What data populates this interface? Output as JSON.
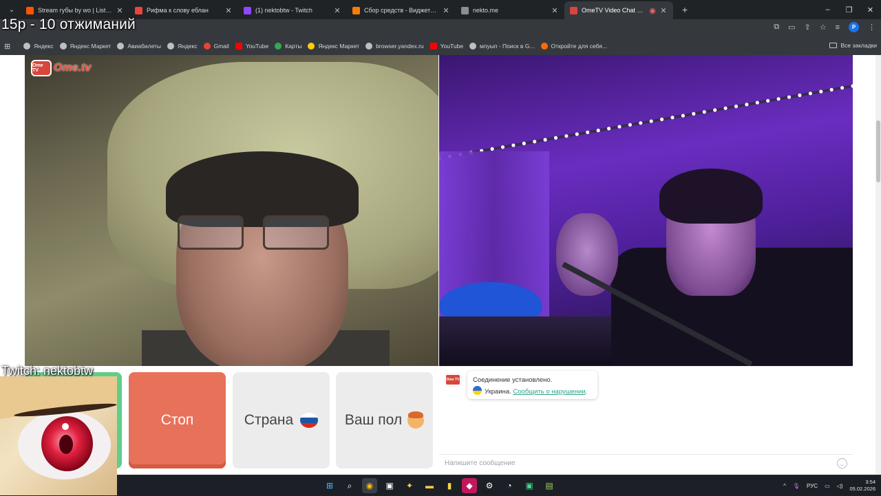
{
  "browser": {
    "tabs": [
      {
        "title": "Stream губы by wo | Listen onli",
        "favicon_color": "#ff5500",
        "active": false
      },
      {
        "title": "Рифма к слову еблан",
        "favicon_color": "#e8453c",
        "active": false
      },
      {
        "title": "(1) nektobtw - Twitch",
        "favicon_color": "#9146ff",
        "active": false
      },
      {
        "title": "Сбор средств - Виджеты - Don",
        "favicon_color": "#f57d07",
        "active": false
      },
      {
        "title": "nekto.me",
        "favicon_color": "#8a8f94",
        "active": false
      },
      {
        "title": "OmeTV Video Chat — Ome",
        "favicon_color": "#d9453b",
        "active": true
      }
    ],
    "new_tab_symbol": "+",
    "window_controls": [
      "–",
      "❐",
      "✕"
    ]
  },
  "overlay": {
    "title": "15р - 10 отжиманий",
    "twitch_label": "Twitch: nektobtw"
  },
  "bookmarks": {
    "items": [
      {
        "label": "Яндекс",
        "color": "#bfbfbf"
      },
      {
        "label": "Яндекс Маркет",
        "color": "#bfbfbf"
      },
      {
        "label": "Авиабилеты",
        "color": "#bfbfbf"
      },
      {
        "label": "Яндекс",
        "color": "#bfbfbf"
      },
      {
        "label": "Gmail",
        "color": "#ea4335"
      },
      {
        "label": "YouTube",
        "color": "#ff0000"
      },
      {
        "label": "Карты",
        "color": "#34a853"
      },
      {
        "label": "Яндекс Маркет",
        "color": "#ffcc00"
      },
      {
        "label": "browser.yandex.ru",
        "color": "#bfbfbf"
      },
      {
        "label": "YouTube",
        "color": "#ff0000"
      },
      {
        "label": "мпуып - Поиск в G...",
        "color": "#bfbfbf"
      },
      {
        "label": "Откройте для себя...",
        "color": "#ff6a00"
      }
    ],
    "all_label": "Все закладки"
  },
  "ometv": {
    "logo_text": "Ome.tv",
    "logo_badge": "Ome TV",
    "buttons": {
      "stop": "Стоп",
      "country": "Страна",
      "gender": "Ваш пол"
    },
    "chat": {
      "connected": "Соединение установлено.",
      "country": "Украина.",
      "report_link": "Сообщить о нарушении",
      "report_suffix": ".",
      "input_placeholder": "Напишите сообщение"
    }
  },
  "taskbar": {
    "tray_lang": "РУС",
    "time": "3:54",
    "date": "05.02.2026",
    "tray_arrow": "^"
  },
  "colors": {
    "stop": "#e8715a",
    "start": "#5fce8a",
    "link": "#2aa385",
    "brand": "#d9453b"
  }
}
